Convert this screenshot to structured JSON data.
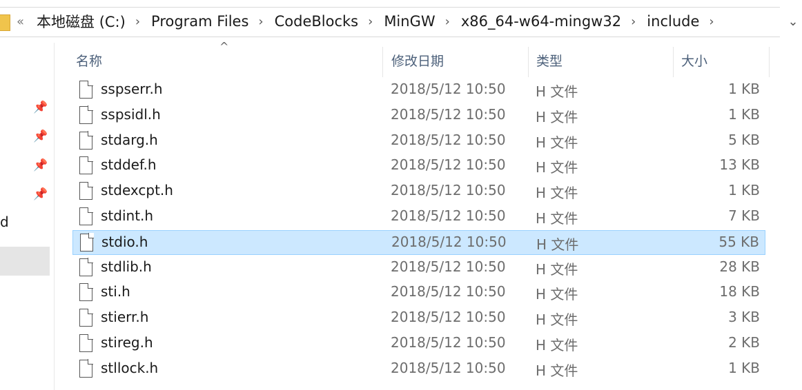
{
  "address": {
    "overflow": "«",
    "crumbs": [
      "本地磁盘 (C:)",
      "Program Files",
      "CodeBlocks",
      "MinGW",
      "x86_64-w64-mingw32",
      "include"
    ],
    "separator": "›",
    "dropdown": "⌄"
  },
  "nav": {
    "partial_label": "d",
    "pins": [
      "📌",
      "📌",
      "📌",
      "📌"
    ]
  },
  "columns": {
    "name": "名称",
    "date": "修改日期",
    "type": "类型",
    "size": "大小",
    "sort_indicator": "^"
  },
  "files": [
    {
      "name": "sspserr.h",
      "date": "2018/5/12 10:50",
      "type": "H 文件",
      "size": "1 KB"
    },
    {
      "name": "sspsidl.h",
      "date": "2018/5/12 10:50",
      "type": "H 文件",
      "size": "1 KB"
    },
    {
      "name": "stdarg.h",
      "date": "2018/5/12 10:50",
      "type": "H 文件",
      "size": "5 KB"
    },
    {
      "name": "stddef.h",
      "date": "2018/5/12 10:50",
      "type": "H 文件",
      "size": "13 KB"
    },
    {
      "name": "stdexcpt.h",
      "date": "2018/5/12 10:50",
      "type": "H 文件",
      "size": "1 KB"
    },
    {
      "name": "stdint.h",
      "date": "2018/5/12 10:50",
      "type": "H 文件",
      "size": "7 KB"
    },
    {
      "name": "stdio.h",
      "date": "2018/5/12 10:50",
      "type": "H 文件",
      "size": "55 KB",
      "selected": true
    },
    {
      "name": "stdlib.h",
      "date": "2018/5/12 10:50",
      "type": "H 文件",
      "size": "28 KB"
    },
    {
      "name": "sti.h",
      "date": "2018/5/12 10:50",
      "type": "H 文件",
      "size": "18 KB"
    },
    {
      "name": "stierr.h",
      "date": "2018/5/12 10:50",
      "type": "H 文件",
      "size": "3 KB"
    },
    {
      "name": "stireg.h",
      "date": "2018/5/12 10:50",
      "type": "H 文件",
      "size": "2 KB"
    },
    {
      "name": "stllock.h",
      "date": "2018/5/12 10:50",
      "type": "H 文件",
      "size": "1 KB"
    }
  ],
  "colors": {
    "selection_bg": "#cce8ff",
    "selection_border": "#99d1ff",
    "header_text": "#4c607a"
  }
}
